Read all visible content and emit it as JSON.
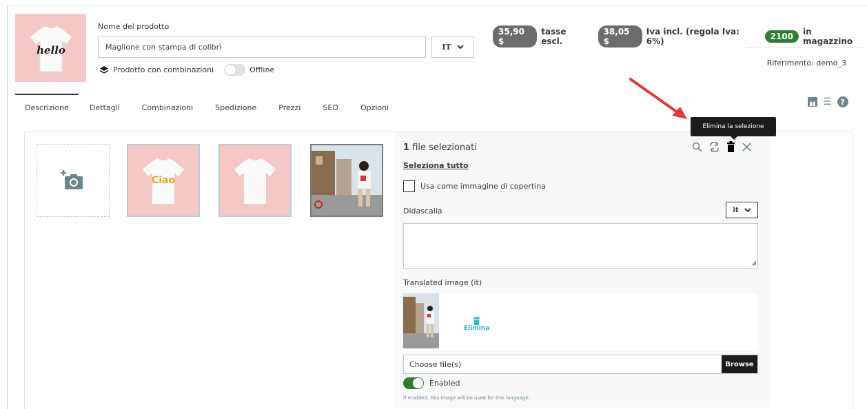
{
  "header": {
    "product_name_label": "Nome del prodotto",
    "product_name_value": "Maglione con stampa di colibrì",
    "lang": "IT",
    "combinations_label": "Prodotto con combinazioni",
    "offline_label": "Offline",
    "price_excl": "35,90 $",
    "price_excl_label": "tasse escl.",
    "price_incl": "38,05 $",
    "price_incl_label": "Iva incl. (regola Iva: 6%)",
    "stock": "2100",
    "stock_label": "in magazzino",
    "reference": "Riferimento: demo_3"
  },
  "tabs": [
    "Descrizione",
    "Dettagli",
    "Combinazioni",
    "Spedizione",
    "Prezzi",
    "SEO",
    "Opzioni"
  ],
  "images": {
    "thumb_texts": [
      "hello",
      "Ciao"
    ]
  },
  "side_panel": {
    "selected_count": "1",
    "selected_label": "file selezionati",
    "select_all": "Seleziona tutto",
    "cover_label": "Usa come immagine di copertina",
    "caption_label": "Didascalia",
    "caption_lang": "it",
    "translated_label": "Translated image (it)",
    "delete_label": "Elimina",
    "file_placeholder": "Choose file(s)",
    "browse_label": "Browse",
    "enabled_label": "Enabled",
    "help_text": "If enabled, this image will be used for this language.",
    "tooltip": "Elimina la selezione"
  },
  "colors": {
    "accent": "#25b9d7",
    "success": "#2e7d32",
    "pill_grey": "#6c6c6c",
    "thumb_pink": "#f4c8c6",
    "annotation_arrow": "#e53935"
  }
}
